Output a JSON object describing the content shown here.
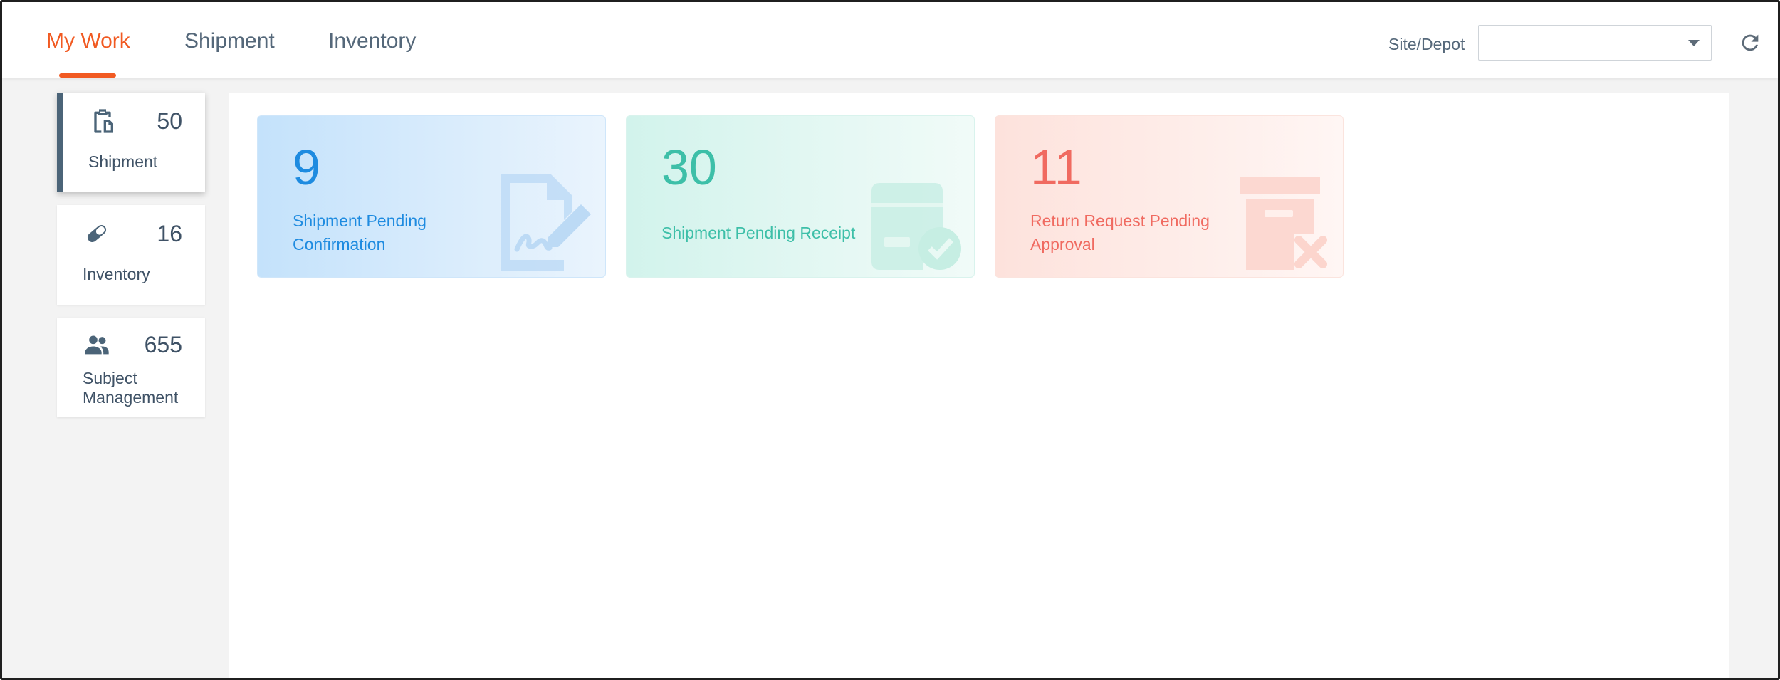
{
  "nav": {
    "tabs": [
      {
        "label": "My Work",
        "active": true
      },
      {
        "label": "Shipment",
        "active": false
      },
      {
        "label": "Inventory",
        "active": false
      }
    ],
    "site_depot_label": "Site/Depot",
    "site_depot_value": "",
    "refresh_icon": "refresh-icon",
    "accent_color": "#f15a22"
  },
  "sidebar": {
    "cards": [
      {
        "label": "Shipment",
        "count": "50",
        "icon": "clipboard-copy-icon",
        "selected": true
      },
      {
        "label": "Inventory",
        "count": "16",
        "icon": "pill-icon",
        "selected": false
      },
      {
        "label": "Subject Management",
        "count": "655",
        "icon": "people-icon",
        "selected": false
      }
    ]
  },
  "main": {
    "cards": [
      {
        "value": "9",
        "label": "Shipment Pending Confirmation",
        "icon": "document-sign-icon",
        "color": "#1e8be0"
      },
      {
        "value": "30",
        "label": "Shipment Pending Receipt",
        "icon": "package-check-icon",
        "color": "#3dbfa8"
      },
      {
        "value": "11",
        "label": "Return Request Pending Approval",
        "icon": "archive-x-icon",
        "color": "#f06a60"
      }
    ]
  }
}
